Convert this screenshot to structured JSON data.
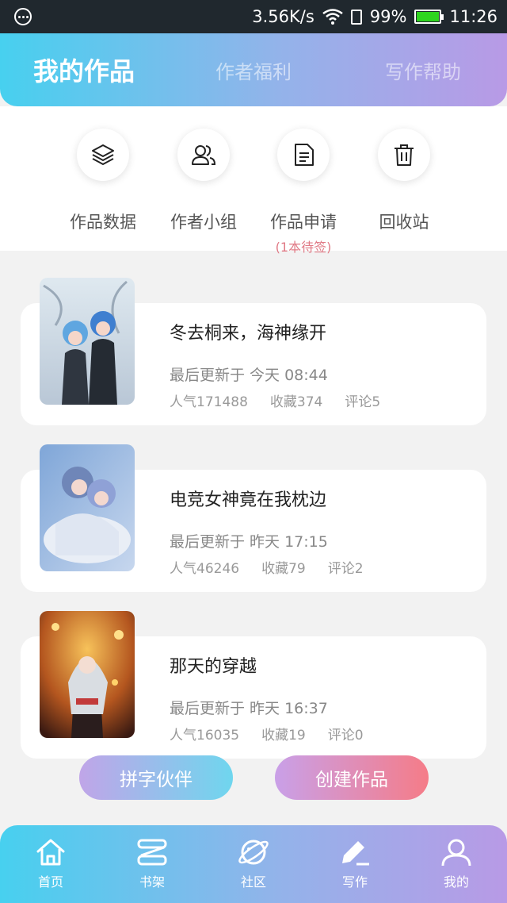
{
  "status": {
    "speed": "3.56K/s",
    "battery": "99%",
    "time": "11:26"
  },
  "header": {
    "tabs": [
      {
        "label": "我的作品"
      },
      {
        "label": "作者福利"
      },
      {
        "label": "写作帮助"
      }
    ]
  },
  "quick_actions": [
    {
      "label": "作品数据",
      "icon": "layers-icon"
    },
    {
      "label": "作者小组",
      "icon": "group-icon"
    },
    {
      "label": "作品申请",
      "icon": "document-icon",
      "sub": "(1本待签)"
    },
    {
      "label": "回收站",
      "icon": "trash-icon"
    }
  ],
  "works": [
    {
      "title": "冬去桐来，海神缘开",
      "updated": "最后更新于 今天 08:44",
      "popularity": "人气171488",
      "favorites": "收藏374",
      "comments": "评论5"
    },
    {
      "title": "电竞女神竟在我枕边",
      "updated": "最后更新于 昨天 17:15",
      "popularity": "人气46246",
      "favorites": "收藏79",
      "comments": "评论2"
    },
    {
      "title": "那天的穿越",
      "updated": "最后更新于 昨天 16:37",
      "popularity": "人气16035",
      "favorites": "收藏19",
      "comments": "评论0"
    }
  ],
  "buttons": {
    "partner": "拼字伙伴",
    "create": "创建作品"
  },
  "nav": [
    {
      "label": "首页"
    },
    {
      "label": "书架"
    },
    {
      "label": "社区"
    },
    {
      "label": "写作"
    },
    {
      "label": "我的"
    }
  ],
  "colors": {
    "gradient_start": "#47d0ef",
    "gradient_end": "#b89ae6",
    "accent_pink": "#f57c88"
  }
}
